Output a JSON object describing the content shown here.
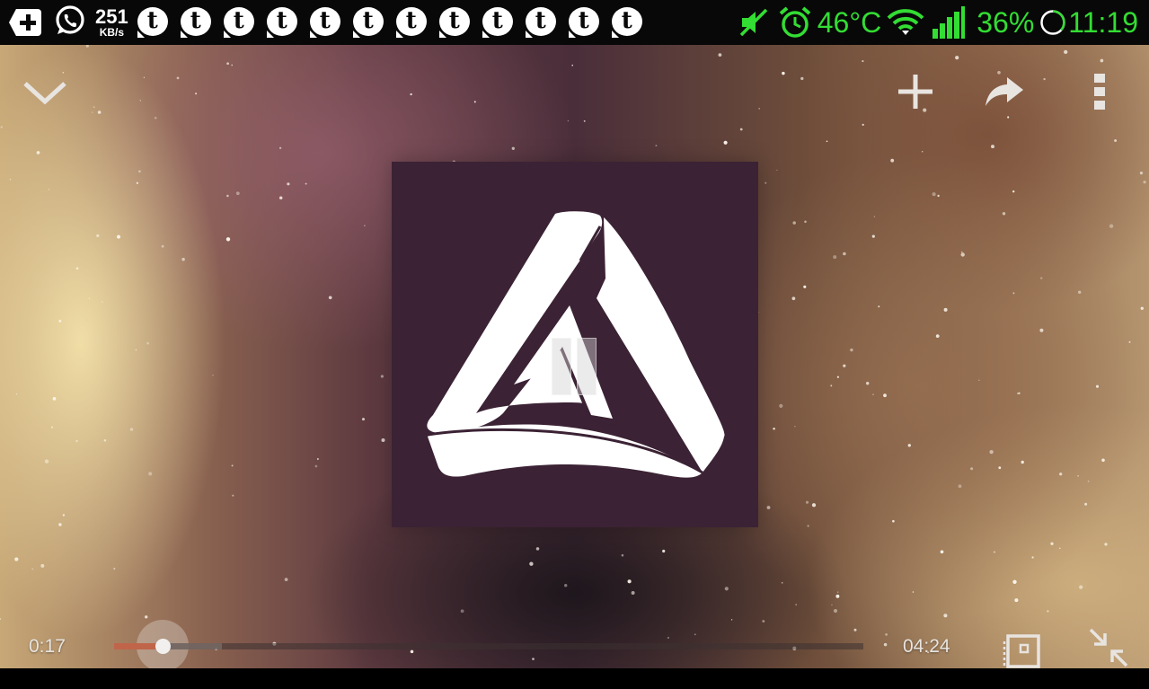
{
  "status_bar": {
    "icons_left": [
      "back-plus-icon",
      "whatsapp-icon",
      "tumblr-icon"
    ],
    "net_speed_value": "251",
    "net_speed_unit": "KB/s",
    "tumblr_icon_letter": "t",
    "tumblr_notification_count": 12,
    "icons_right": [
      "mute-icon",
      "alarm-icon",
      "wifi-icon",
      "signal-icon",
      "battery-icon"
    ],
    "temperature": "46°C",
    "battery": "36%",
    "time": "11:19",
    "accent_color": "#33dd33"
  },
  "player": {
    "top_bar": {
      "collapse_icon": "chevron-down-icon",
      "add_icon": "plus-icon",
      "share_icon": "share-icon",
      "menu_icon": "more-vert-icon"
    },
    "artwork": {
      "background_color": "#3b2234",
      "logo": "penrose-triangle-logo"
    },
    "playback_state": "paused",
    "elapsed": "0:17",
    "duration": "04:24",
    "progress_fraction": 0.065,
    "buffer_fraction": 0.144,
    "progress_color": "#c0654a",
    "bottom_right_icons": [
      "cast-icon",
      "minimize-icon"
    ]
  }
}
